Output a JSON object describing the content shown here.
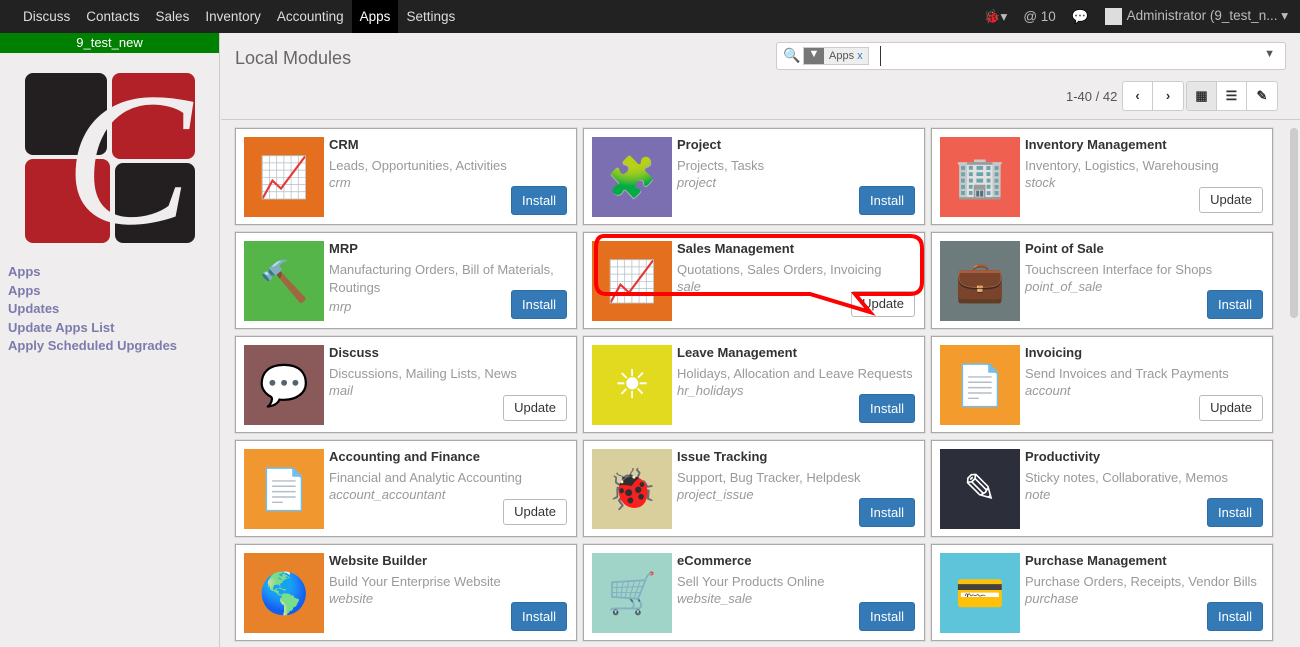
{
  "topbar": {
    "menu": [
      "Discuss",
      "Contacts",
      "Sales",
      "Inventory",
      "Accounting",
      "Apps",
      "Settings"
    ],
    "active": "Apps",
    "mentions": "10",
    "user": "Administrator (9_test_n..."
  },
  "sidebar": {
    "db_name": "9_test_new",
    "links": [
      "Apps",
      "Apps",
      "Updates",
      "Update Apps List",
      "Apply Scheduled Upgrades"
    ]
  },
  "header": {
    "title": "Local Modules",
    "facet": "Apps",
    "facet_remove": "x",
    "pager": "1-40 / 42"
  },
  "colors": {
    "install": "#337ab7",
    "annotation": "#ff0000"
  },
  "modules": [
    {
      "name": "CRM",
      "summary": "Leads, Opportunities, Activities",
      "tech": "crm",
      "action": "Install",
      "color": "#e46f1f",
      "glyph": "📈"
    },
    {
      "name": "Project",
      "summary": "Projects, Tasks",
      "tech": "project",
      "action": "Install",
      "color": "#7b6fb2",
      "glyph": "🧩"
    },
    {
      "name": "Inventory Management",
      "summary": "Inventory, Logistics, Warehousing",
      "tech": "stock",
      "action": "Update",
      "color": "#f06050",
      "glyph": "🏢"
    },
    {
      "name": "MRP",
      "summary": "Manufacturing Orders, Bill of Materials, Routings",
      "tech": "mrp",
      "action": "Install",
      "color": "#55b549",
      "glyph": "🔨"
    },
    {
      "name": "Sales Management",
      "summary": "Quotations, Sales Orders, Invoicing",
      "tech": "sale",
      "action": "Update",
      "color": "#e46f1f",
      "glyph": "📈"
    },
    {
      "name": "Point of Sale",
      "summary": "Touchscreen Interface for Shops",
      "tech": "point_of_sale",
      "action": "Install",
      "color": "#6d7b7c",
      "glyph": "💼"
    },
    {
      "name": "Discuss",
      "summary": "Discussions, Mailing Lists, News",
      "tech": "mail",
      "action": "Update",
      "color": "#8a5a5a",
      "glyph": "💬"
    },
    {
      "name": "Leave Management",
      "summary": "Holidays, Allocation and Leave Requests",
      "tech": "hr_holidays",
      "action": "Install",
      "color": "#e2da1f",
      "glyph": "☀"
    },
    {
      "name": "Invoicing",
      "summary": "Send Invoices and Track Payments",
      "tech": "account",
      "action": "Update",
      "color": "#f39b2d",
      "glyph": "📄"
    },
    {
      "name": "Accounting and Finance",
      "summary": "Financial and Analytic Accounting",
      "tech": "account_accountant",
      "action": "Update",
      "color": "#f0982f",
      "glyph": "📄"
    },
    {
      "name": "Issue Tracking",
      "summary": "Support, Bug Tracker, Helpdesk",
      "tech": "project_issue",
      "action": "Install",
      "color": "#d8cf9d",
      "glyph": "🐞"
    },
    {
      "name": "Productivity",
      "summary": "Sticky notes, Collaborative, Memos",
      "tech": "note",
      "action": "Install",
      "color": "#2c2e3a",
      "glyph": "✎"
    },
    {
      "name": "Website Builder",
      "summary": "Build Your Enterprise Website",
      "tech": "website",
      "action": "Install",
      "color": "#e8822a",
      "glyph": "🌎"
    },
    {
      "name": "eCommerce",
      "summary": "Sell Your Products Online",
      "tech": "website_sale",
      "action": "Install",
      "color": "#a1d4c8",
      "glyph": "🛒"
    },
    {
      "name": "Purchase Management",
      "summary": "Purchase Orders, Receipts, Vendor Bills",
      "tech": "purchase",
      "action": "Install",
      "color": "#5dc4d9",
      "glyph": "💳"
    }
  ]
}
